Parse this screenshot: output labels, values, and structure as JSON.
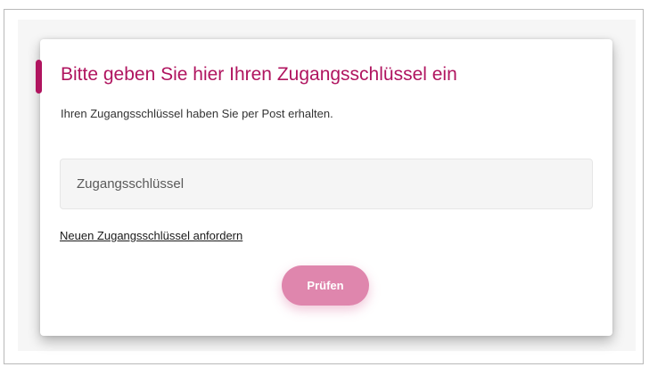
{
  "dialog": {
    "title": "Bitte geben Sie hier Ihren Zugangsschlüssel ein",
    "subtitle": "Ihren Zugangsschlüssel haben Sie per Post erhalten.",
    "accent_color": "#b0145f"
  },
  "key_field": {
    "placeholder": "Zugangsschlüssel",
    "value": ""
  },
  "request_link": {
    "label": "Neuen Zugangsschlüssel anfordern"
  },
  "submit_button": {
    "label": "Prüfen",
    "color": "#df86ad"
  }
}
